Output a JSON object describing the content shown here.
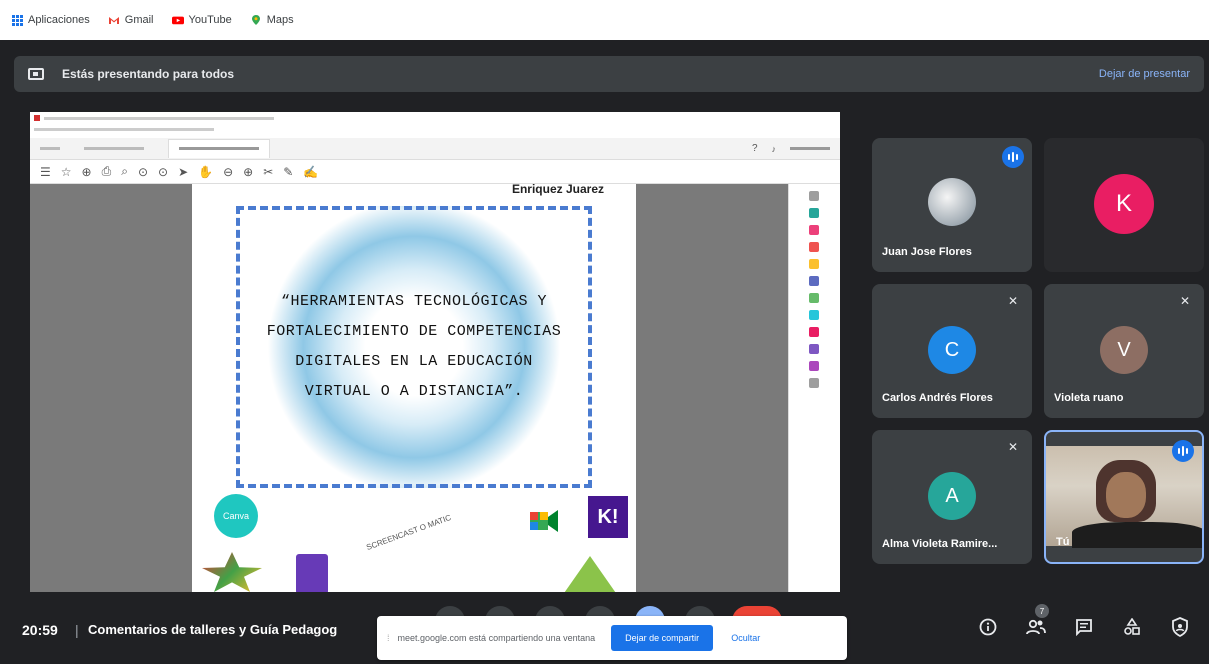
{
  "bookmarks": {
    "apps": "Aplicaciones",
    "gmail": "Gmail",
    "youtube": "YouTube",
    "maps": "Maps"
  },
  "presenting": {
    "message": "Estás presentando para todos",
    "stop_label": "Dejar de presentar"
  },
  "pdf": {
    "page_header": "Enriquez Juarez",
    "title_text": "“HERRAMIENTAS TECNOLÓGICAS Y FORTALECIMIENTO DE COMPETENCIAS DIGITALES EN LA EDUCACIÓN VIRTUAL O A DISTANCIA”.",
    "logos": [
      "Canva",
      "SCREENCAST O MATIC",
      "K!"
    ]
  },
  "participants": [
    {
      "name": "Juan Jose Flores",
      "speaking": true,
      "initial": ""
    },
    {
      "name": "",
      "initial": "K",
      "color": "#e91e63"
    },
    {
      "name": "Carlos Andrés Flores",
      "initial": "C",
      "color": "#1e88e5",
      "muted": true
    },
    {
      "name": "Violeta ruano",
      "initial": "V",
      "color": "#8d6e63",
      "muted": true
    },
    {
      "name": "Alma Violeta Ramire...",
      "initial": "A",
      "color": "#26a69a",
      "muted": true
    },
    {
      "name": "Tú",
      "speaking": true,
      "self": true
    }
  ],
  "bottom": {
    "time": "20:59",
    "separator": "|",
    "meeting_title": "Comentarios de talleres y Guía Pedagog",
    "participant_count": "7"
  },
  "share_banner": {
    "message": "meet.google.com está compartiendo una ventana",
    "stop_label": "Dejar de compartir",
    "hide_label": "Ocultar"
  }
}
